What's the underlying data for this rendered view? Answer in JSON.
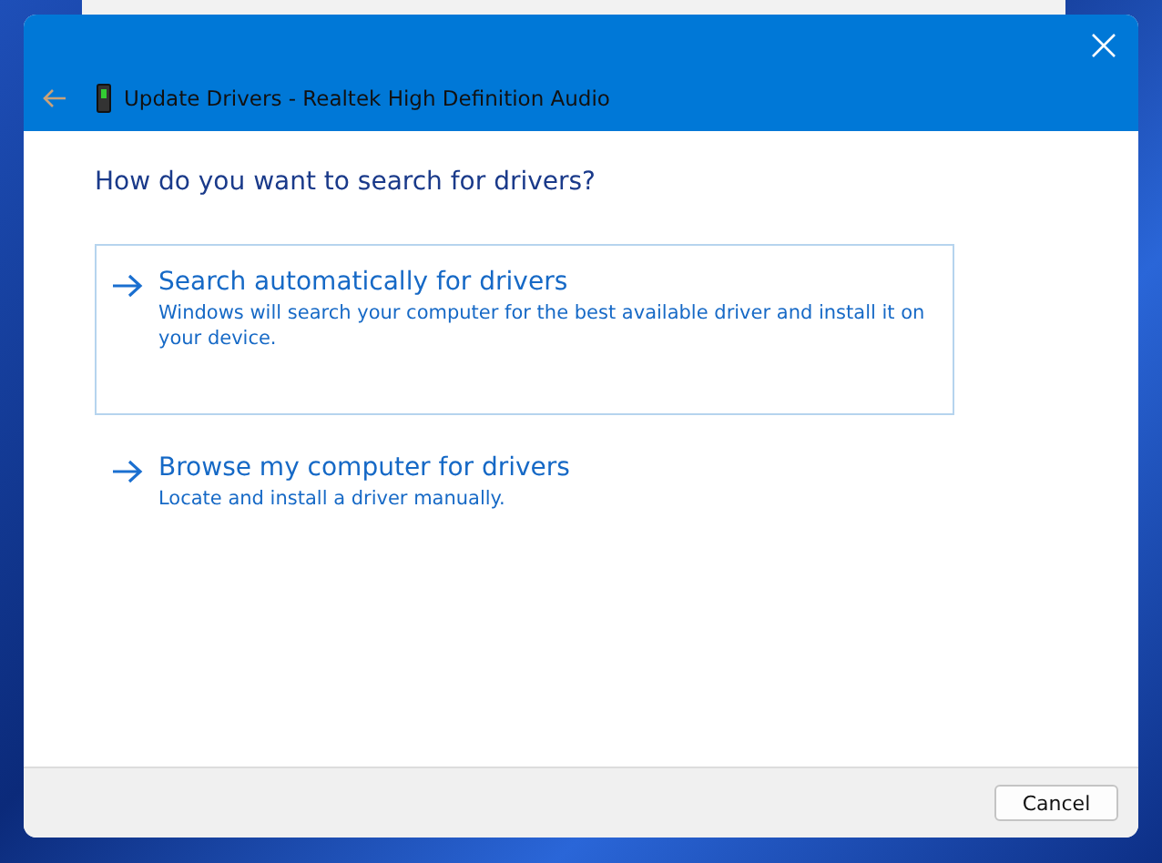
{
  "window": {
    "title": "Update Drivers - Realtek High Definition Audio"
  },
  "heading": "How do you want to search for drivers?",
  "options": [
    {
      "title": "Search automatically for drivers",
      "description": "Windows will search your computer for the best available driver and install it on your device.",
      "selected": true
    },
    {
      "title": "Browse my computer for drivers",
      "description": "Locate and install a driver manually.",
      "selected": false
    }
  ],
  "buttons": [
    "Cancel"
  ]
}
